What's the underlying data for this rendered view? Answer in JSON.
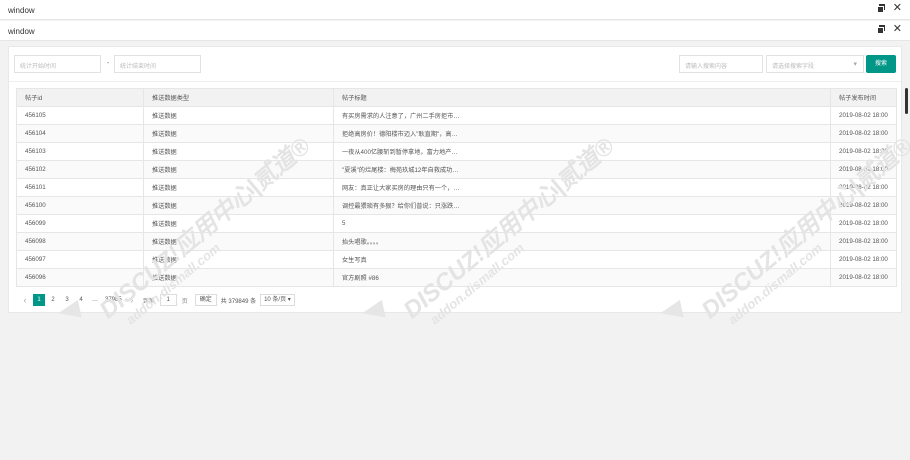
{
  "window1": {
    "title": "window"
  },
  "window2": {
    "title": "window"
  },
  "filters": {
    "start_placeholder": "统计开始时间",
    "end_placeholder": "统计结束时间",
    "separator": "-",
    "search_input_placeholder": "请输入搜索内容",
    "field_select_placeholder": "请选择搜索字段",
    "search_button": "搜索"
  },
  "table": {
    "headers": [
      "帖子id",
      "推送数据类型",
      "帖子标题",
      "帖子发布时间"
    ],
    "rows": [
      {
        "id": "456105",
        "type": "推送数据",
        "title": "有买房需求的人注意了，广州二手房拒市…",
        "time": "2019-08-02 18:00"
      },
      {
        "id": "456104",
        "type": "推送数据",
        "title": "拒绝高房价！德阳楼市迈入\"耿直期\"，高…",
        "time": "2019-08-02 18:00"
      },
      {
        "id": "456103",
        "type": "推送数据",
        "title": "一夜从400亿腰斩到暂停拿地，富力地产…",
        "time": "2019-08-02 18:00"
      },
      {
        "id": "456102",
        "type": "推送数据",
        "title": "\"夏溪\"的烂尾楼：梅苑玖城12年自救成功…",
        "time": "2019-08-02 18:00"
      },
      {
        "id": "456101",
        "type": "推送数据",
        "title": "网友：真正让大家买房的理由只有一个，…",
        "time": "2019-08-02 18:00"
      },
      {
        "id": "456100",
        "type": "推送数据",
        "title": "调控最猥琐有多狠？给你们普说：只涨跌…",
        "time": "2019-08-02 18:00"
      },
      {
        "id": "456099",
        "type": "推送数据",
        "title": "5",
        "time": "2019-08-02 18:00"
      },
      {
        "id": "456098",
        "type": "推送数据",
        "title": "抬头唱歌。。。。",
        "time": "2019-08-02 18:00"
      },
      {
        "id": "456097",
        "type": "推送数据",
        "title": "女生写真",
        "time": "2019-08-02 18:00"
      },
      {
        "id": "456096",
        "type": "推送数据",
        "title": "官方剧照 #86",
        "time": "2019-08-02 18:00"
      }
    ]
  },
  "pager": {
    "pages": [
      "1",
      "2",
      "3",
      "4"
    ],
    "ellipsis": "…",
    "last_page": "37985",
    "goto_label": "到第",
    "goto_value": "1",
    "page_unit": "页",
    "confirm": "确定",
    "total": "共 379849 条",
    "page_size": "10 条/页"
  },
  "watermark": {
    "line1": "DISCUZ!应用中心|贰道®",
    "line2": "addon.dismall.com"
  },
  "colors": {
    "accent": "#009688"
  },
  "icons": {
    "restore": "restore-icon",
    "close": "close-icon"
  }
}
